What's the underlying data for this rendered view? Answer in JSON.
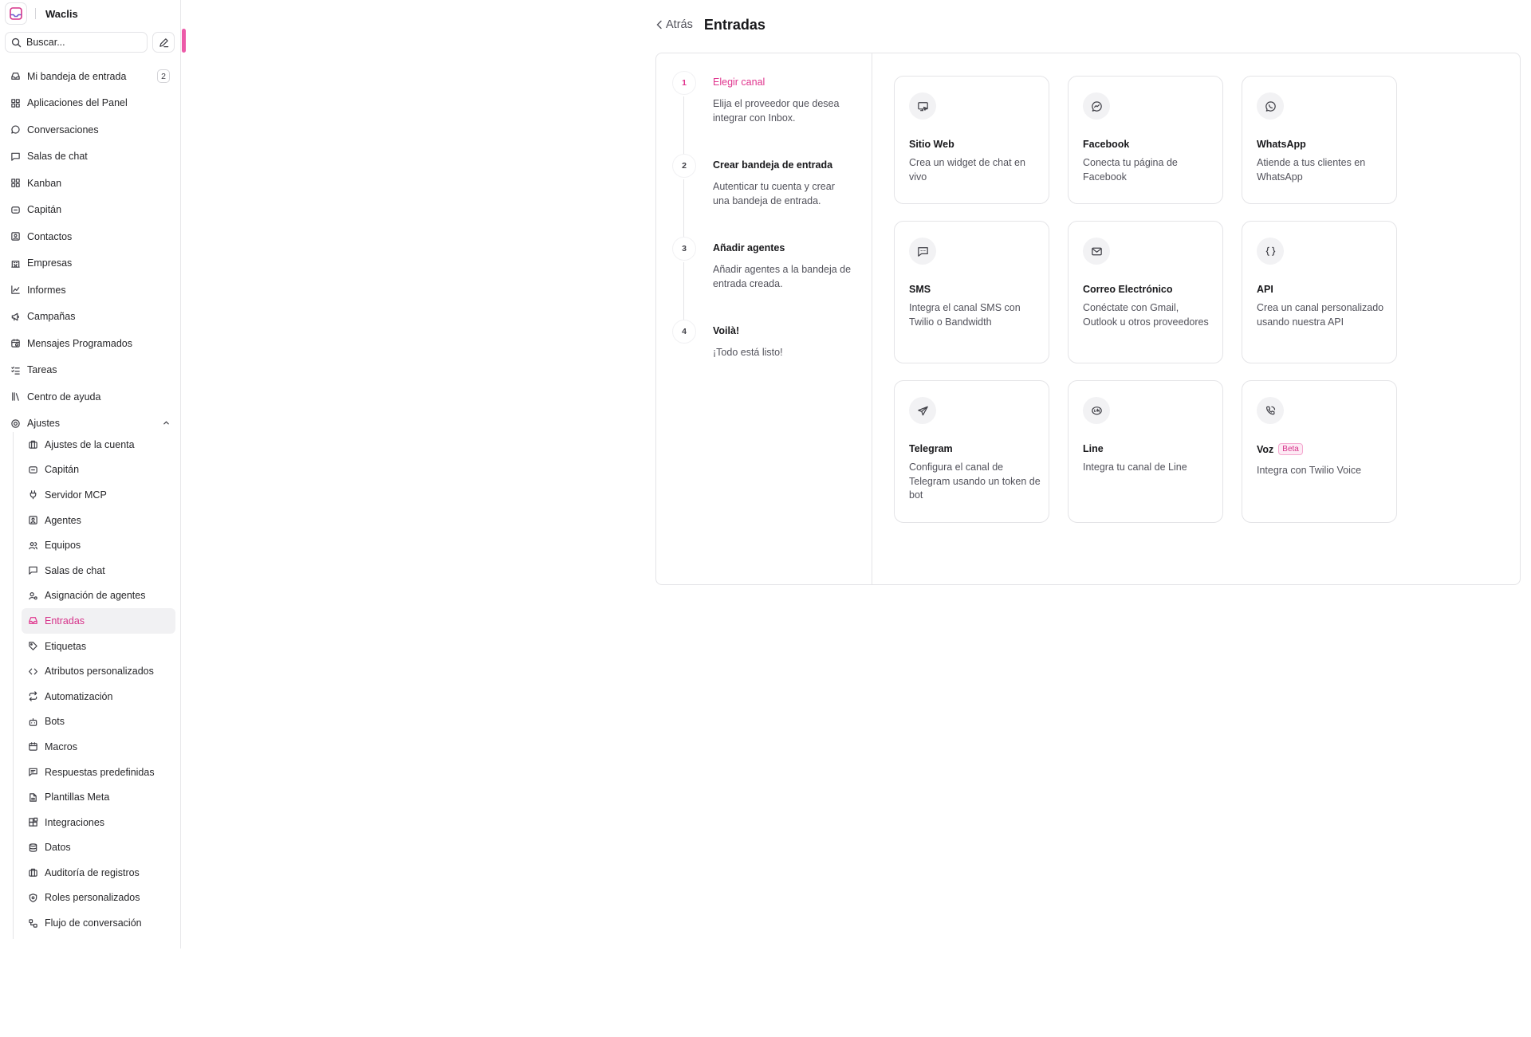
{
  "brand": {
    "name": "Waclis"
  },
  "search": {
    "placeholder": "Buscar..."
  },
  "nav": [
    {
      "label": "Mi bandeja de entrada",
      "icon": "inbox-icon",
      "count": "2"
    },
    {
      "label": "Aplicaciones del Panel",
      "icon": "grid-icon"
    },
    {
      "label": "Conversaciones",
      "icon": "chat-bubble-icon"
    },
    {
      "label": "Salas de chat",
      "icon": "message-square-icon"
    },
    {
      "label": "Kanban",
      "icon": "kanban-icon"
    },
    {
      "label": "Capitán",
      "icon": "captain-icon"
    },
    {
      "label": "Contactos",
      "icon": "contacts-icon"
    },
    {
      "label": "Empresas",
      "icon": "building-icon"
    },
    {
      "label": "Informes",
      "icon": "chart-line-icon"
    },
    {
      "label": "Campañas",
      "icon": "megaphone-icon"
    },
    {
      "label": "Mensajes Programados",
      "icon": "calendar-clock-icon"
    },
    {
      "label": "Tareas",
      "icon": "list-checks-icon"
    },
    {
      "label": "Centro de ayuda",
      "icon": "library-icon"
    },
    {
      "label": "Ajustes",
      "icon": "settings-icon"
    }
  ],
  "settings_sub": [
    {
      "label": "Ajustes de la cuenta",
      "icon": "briefcase-icon"
    },
    {
      "label": "Capitán",
      "icon": "captain-icon"
    },
    {
      "label": "Servidor MCP",
      "icon": "plug-icon"
    },
    {
      "label": "Agentes",
      "icon": "user-square-icon"
    },
    {
      "label": "Equipos",
      "icon": "users-icon"
    },
    {
      "label": "Salas de chat",
      "icon": "message-square-icon"
    },
    {
      "label": "Asignación de agentes",
      "icon": "user-cog-icon"
    },
    {
      "label": "Entradas",
      "icon": "inbox-icon",
      "active": true
    },
    {
      "label": "Etiquetas",
      "icon": "tag-icon"
    },
    {
      "label": "Atributos personalizados",
      "icon": "code-icon"
    },
    {
      "label": "Automatización",
      "icon": "repeat-icon"
    },
    {
      "label": "Bots",
      "icon": "bot-icon"
    },
    {
      "label": "Macros",
      "icon": "calendar-icon"
    },
    {
      "label": "Respuestas predefinidas",
      "icon": "message-text-icon"
    },
    {
      "label": "Plantillas Meta",
      "icon": "file-text-icon"
    },
    {
      "label": "Integraciones",
      "icon": "blocks-icon"
    },
    {
      "label": "Datos",
      "icon": "database-icon"
    },
    {
      "label": "Auditoría de registros",
      "icon": "briefcase-icon"
    },
    {
      "label": "Roles personalizados",
      "icon": "shield-icon"
    },
    {
      "label": "Flujo de conversación",
      "icon": "workflow-icon"
    }
  ],
  "header": {
    "back_label": "Atrás",
    "title": "Entradas"
  },
  "steps": [
    {
      "num": "1",
      "title": "Elegir canal",
      "desc": "Elija el proveedor que desea integrar con Inbox.",
      "active": true
    },
    {
      "num": "2",
      "title": "Crear bandeja de entrada",
      "desc": "Autenticar tu cuenta y crear una bandeja de entrada."
    },
    {
      "num": "3",
      "title": "Añadir agentes",
      "desc": "Añadir agentes a la bandeja de entrada creada."
    },
    {
      "num": "4",
      "title": "Voilà!",
      "desc": "¡Todo está listo!"
    }
  ],
  "channels": [
    {
      "title": "Sitio Web",
      "desc": "Crea un widget de chat en vivo",
      "icon": "website-icon"
    },
    {
      "title": "Facebook",
      "desc": "Conecta tu página de Facebook",
      "icon": "messenger-icon"
    },
    {
      "title": "WhatsApp",
      "desc": "Atiende a tus clientes en WhatsApp",
      "icon": "whatsapp-icon"
    },
    {
      "title": "SMS",
      "desc": "Integra el canal SMS con Twilio o Bandwidth",
      "icon": "sms-icon"
    },
    {
      "title": "Correo Electrónico",
      "desc": "Conéctate con Gmail, Outlook u otros proveedores",
      "icon": "mail-icon"
    },
    {
      "title": "API",
      "desc": "Crea un canal personalizado usando nuestra API",
      "icon": "braces-icon"
    },
    {
      "title": "Telegram",
      "desc": "Configura el canal de Telegram usando un token de bot",
      "icon": "telegram-icon"
    },
    {
      "title": "Line",
      "desc": "Integra tu canal de Line",
      "icon": "line-icon"
    },
    {
      "title": "Voz",
      "desc": "Integra con Twilio Voice",
      "icon": "phone-icon",
      "badge": "Beta"
    }
  ],
  "colors": {
    "accent": "#e0358e",
    "border": "#e4e4e7",
    "active_bg": "#f1f1f3"
  }
}
